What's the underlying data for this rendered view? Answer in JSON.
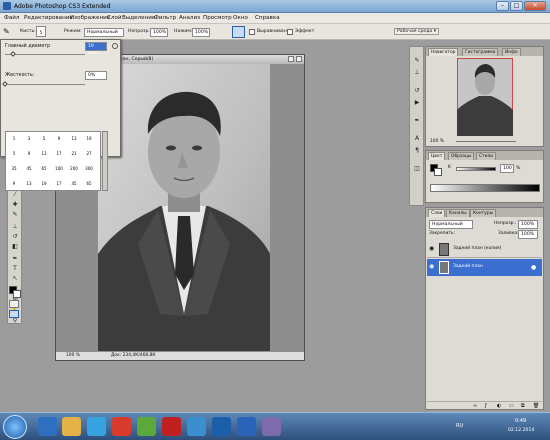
{
  "window": {
    "title": "Adobe Photoshop CS3 Extended",
    "controls": {
      "minimize": "–",
      "maximize": "□",
      "close": "✕"
    }
  },
  "menu": [
    "Файл",
    "Редактирование",
    "Изображение",
    "Слой",
    "Выделение",
    "Фильтр",
    "Анализ",
    "Просмотр",
    "Окно",
    "Справка"
  ],
  "options": {
    "brush_label": "Кисть:",
    "brush_size": "5",
    "mode_label": "Режим:",
    "mode_value": "Нормальный",
    "opacity_label": "Непрозр.:",
    "opacity_value": "100%",
    "flow_label": "Нажим:",
    "flow_value": "100%",
    "align_label": "Выравнивание",
    "sample_label": "Эффект",
    "workspace_label": "Рабочая среда ▾"
  },
  "brush_picker": {
    "diameter_label": "Главный диаметр",
    "diameter_value": "19 пикс",
    "hardness_label": "Жесткость:",
    "hardness_value": "0%",
    "diameter_level": 0.1,
    "hardness_level": 0.0,
    "sizes": [
      [
        "1",
        "3",
        "5",
        "9",
        "13",
        "19"
      ],
      [
        "5",
        "9",
        "13",
        "17",
        "21",
        "27"
      ],
      [
        "35",
        "45",
        "65",
        "100",
        "200",
        "300"
      ],
      [
        "9",
        "13",
        "19",
        "17",
        "45",
        "65"
      ]
    ]
  },
  "document": {
    "title": "...jpg @ 100% (Задний план, Серый/8)",
    "zoom": "100 %",
    "doc_info": "Док: 234,4К/468,8К"
  },
  "navigator": {
    "tabs": [
      "Навигатор",
      "Гистограмма",
      "Инфо"
    ],
    "zoom": "100 %"
  },
  "color": {
    "tabs": [
      "Цвет",
      "Образцы",
      "Стили"
    ],
    "channel": "K",
    "value": "100",
    "unit": "%"
  },
  "layers": {
    "tabs": [
      "Слои",
      "Каналы",
      "Контуры"
    ],
    "blend": "Нормальный",
    "opacity_label": "Непрозр.:",
    "opacity": "100%",
    "lock_label": "Закрепить:",
    "fill_label": "Заливка:",
    "fill": "100%",
    "rows": [
      {
        "name": "Задний план (копия)",
        "selected": false
      },
      {
        "name": "Задний план",
        "selected": true
      }
    ]
  },
  "taskbar": {
    "lang": "RU",
    "time": "0:49",
    "date": "02.12.2014"
  },
  "colors": {
    "workspace": "#9c9c9c",
    "selection": "#3a6fd0",
    "titlebar": "#8fb3d9"
  }
}
